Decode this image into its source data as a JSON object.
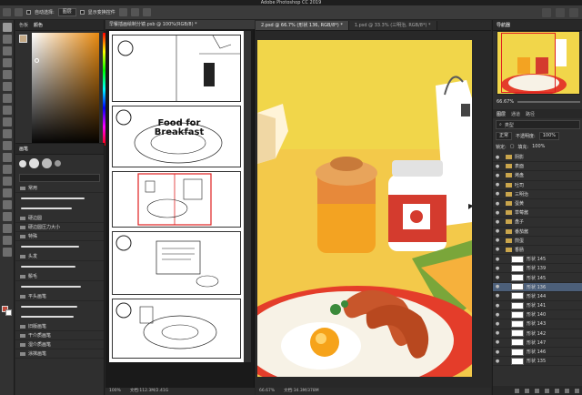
{
  "app_title": "Adobe Photoshop CC 2019",
  "options_bar": {
    "auto_select_label": "自动选择:",
    "auto_select_value": "图层",
    "transform_label": "显示变换控件"
  },
  "left_panel": {
    "tabs": [
      "色板",
      "颜色"
    ],
    "active_tab": "颜色",
    "fg_color": "#c24a3a",
    "bg_color": "#ffffff"
  },
  "brush_panel": {
    "tab": "画笔",
    "folders": [
      "常用",
      "硬边圆",
      "硬边圆压力大小",
      "特殊"
    ],
    "folders2": [
      "头发",
      "鬃毛",
      "平头画笔"
    ],
    "more_folders": [
      "旧版画笔",
      "干介质画笔",
      "湿介质画笔",
      "涂抹画笔"
    ]
  },
  "doc_left": {
    "tab": "早餐插画绘制分镜.psb @ 100%(RGB/8) *",
    "zoom": "100%",
    "docsize": "文档:112.3M/2.41G",
    "panel_text": "Food for Breakfast"
  },
  "doc_tabs": [
    {
      "label": "2.psd @ 66.7% (形状 136, RGB/8*) *",
      "active": true
    },
    {
      "label": "1.psd @ 33.3% (三明治, RGB/8*) *",
      "active": false
    }
  ],
  "canvas_status": {
    "zoom": "66.67%",
    "docsize": "文档:34.3M/378M"
  },
  "navigator": {
    "tab": "导航器",
    "zoom": "66.67%"
  },
  "layers_panel": {
    "tabs": [
      "图层",
      "通道",
      "路径"
    ],
    "active_tab": "图层",
    "filter_label": "类型",
    "blend_mode": "正常",
    "opacity_label": "不透明度:",
    "opacity": "100%",
    "lock_label": "锁定:",
    "fill_label": "填充:",
    "fill": "100%",
    "layers": [
      {
        "name": "阴影",
        "type": "group",
        "indent": 0
      },
      {
        "name": "表面",
        "type": "group",
        "indent": 0
      },
      {
        "name": "烤盘",
        "type": "group",
        "indent": 0
      },
      {
        "name": "吐司",
        "type": "group",
        "indent": 0
      },
      {
        "name": "三明治",
        "type": "group",
        "indent": 0
      },
      {
        "name": "蛋黄",
        "type": "group",
        "indent": 0
      },
      {
        "name": "草莓酱",
        "type": "group",
        "indent": 0
      },
      {
        "name": "盘子",
        "type": "group",
        "indent": 0
      },
      {
        "name": "番茄酱",
        "type": "group",
        "indent": 0
      },
      {
        "name": "煎蛋",
        "type": "group",
        "indent": 0
      },
      {
        "name": "香肠",
        "type": "group",
        "indent": 0
      },
      {
        "name": "形状 145",
        "type": "layer",
        "indent": 1
      },
      {
        "name": "形状 139",
        "type": "layer",
        "indent": 1
      },
      {
        "name": "形状 145",
        "type": "layer",
        "indent": 1
      },
      {
        "name": "形状 136",
        "type": "layer",
        "indent": 1,
        "selected": true
      },
      {
        "name": "形状 144",
        "type": "layer",
        "indent": 1
      },
      {
        "name": "形状 141",
        "type": "layer",
        "indent": 1
      },
      {
        "name": "形状 140",
        "type": "layer",
        "indent": 1
      },
      {
        "name": "形状 143",
        "type": "layer",
        "indent": 1
      },
      {
        "name": "形状 142",
        "type": "layer",
        "indent": 1
      },
      {
        "name": "形状 147",
        "type": "layer",
        "indent": 1
      },
      {
        "name": "形状 146",
        "type": "layer",
        "indent": 1
      },
      {
        "name": "形状 135",
        "type": "layer",
        "indent": 1
      }
    ]
  },
  "colors": {
    "canvas_bg": "#f1d64a",
    "plate": "#f7f2e6",
    "sausage": "#c8562b",
    "jam_red": "#d43b2e",
    "selection_red": "#e02020"
  }
}
